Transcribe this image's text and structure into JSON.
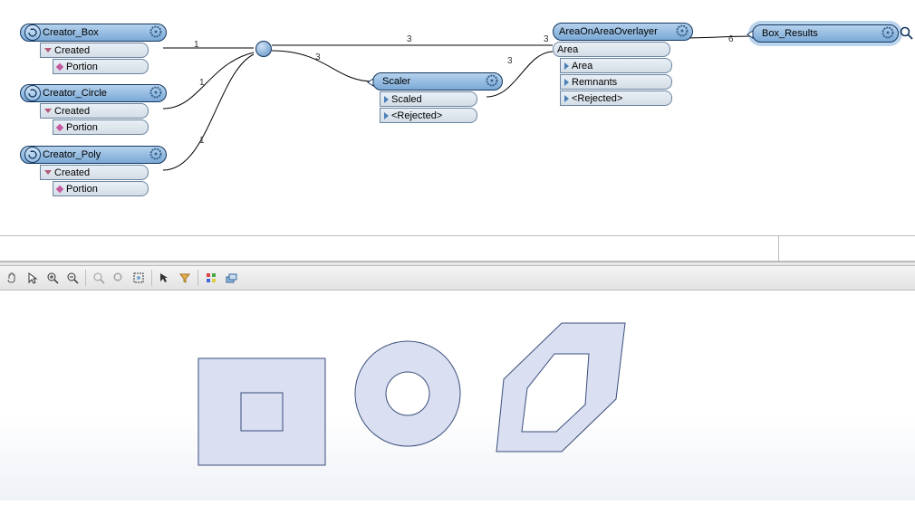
{
  "nodes": {
    "creator_box": {
      "title": "Creator_Box",
      "ports": [
        "Created",
        "Portion"
      ]
    },
    "creator_circle": {
      "title": "Creator_Circle",
      "ports": [
        "Created",
        "Portion"
      ]
    },
    "creator_poly": {
      "title": "Creator_Poly",
      "ports": [
        "Created",
        "Portion"
      ]
    },
    "scaler": {
      "title": "Scaler",
      "ports": [
        "Scaled",
        "<Rejected>"
      ]
    },
    "overlayer": {
      "title": "AreaOnAreaOverlayer",
      "in": "Area",
      "ports": [
        "Area",
        "Remnants",
        "<Rejected>"
      ]
    },
    "results": {
      "title": "Box_Results"
    }
  },
  "counts": {
    "c1": "1",
    "c2": "1",
    "c3": "1",
    "c4": "3",
    "c5": "3",
    "c6": "3",
    "c7": "3",
    "c8": "6"
  },
  "toolbar": {
    "icons": [
      "hand",
      "cursor",
      "zoom-in",
      "zoom-out",
      "zoom-reset",
      "zoom-sel",
      "extent",
      "select",
      "filter",
      "divider",
      "palette",
      "layers"
    ]
  }
}
